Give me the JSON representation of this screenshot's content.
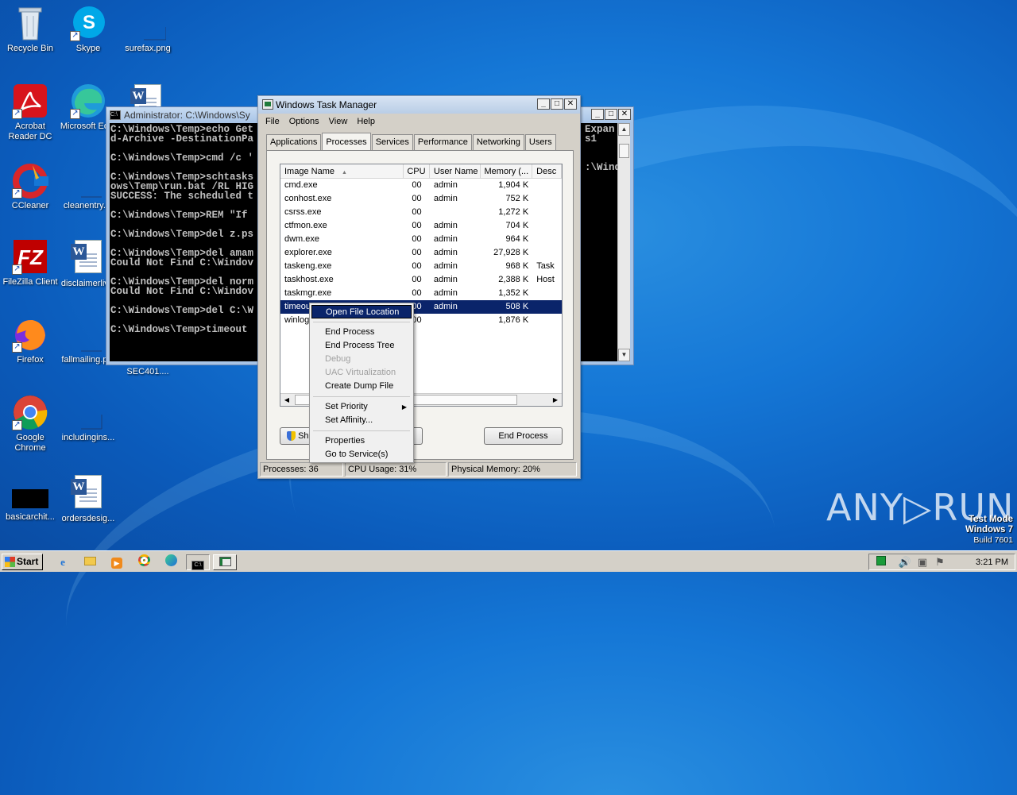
{
  "desktop": {
    "icons": [
      {
        "label": "Recycle Bin",
        "icon": "recycle-bin-icon"
      },
      {
        "label": "Skype",
        "icon": "skype-icon"
      },
      {
        "label": "surefax.png",
        "icon": "image-file-icon"
      },
      {
        "label": "Acrobat Reader DC",
        "icon": "acrobat-icon"
      },
      {
        "label": "Microsoft Ed...",
        "icon": "edge-icon"
      },
      {
        "label": "CCleaner",
        "icon": "ccleaner-icon"
      },
      {
        "label": "cleanentry....",
        "icon": "file-icon"
      },
      {
        "label": "FileZilla Client",
        "icon": "filezilla-icon"
      },
      {
        "label": "disclaimerliv...",
        "icon": "word-doc-icon"
      },
      {
        "label": "Firefox",
        "icon": "firefox-icon"
      },
      {
        "label": "fallmailing.p...",
        "icon": "file-icon"
      },
      {
        "label": "SEC401....",
        "icon": "file-icon"
      },
      {
        "label": "Google Chrome",
        "icon": "chrome-icon"
      },
      {
        "label": "includingins...",
        "icon": "file-icon"
      },
      {
        "label": "basicarchit...",
        "icon": "file-icon"
      },
      {
        "label": "ordersdesig...",
        "icon": "word-doc-icon"
      }
    ]
  },
  "cmd": {
    "title": "Administrator: C:\\Windows\\Sy",
    "lines": [
      "C:\\Windows\\Temp>echo Get",
      "d-Archive -DestinationPa",
      "",
      "C:\\Windows\\Temp>cmd /c '",
      "",
      "C:\\Windows\\Temp>schtasks",
      "ows\\Temp\\run.bat /RL HIG",
      "SUCCESS: The scheduled t",
      "",
      "C:\\Windows\\Temp>REM \"If",
      "",
      "C:\\Windows\\Temp>del z.ps",
      "",
      "C:\\Windows\\Temp>del amam",
      "Could Not Find C:\\Windov",
      "",
      "C:\\Windows\\Temp>del norm",
      "Could Not Find C:\\Windov",
      "",
      "C:\\Windows\\Temp>del C:\\W",
      "",
      "C:\\Windows\\Temp>timeout"
    ],
    "right_lines": [
      "Expan",
      "s1",
      "",
      "",
      ":\\Wind"
    ]
  },
  "taskmgr": {
    "title": "Windows Task Manager",
    "menu": [
      "File",
      "Options",
      "View",
      "Help"
    ],
    "tabs": [
      "Applications",
      "Processes",
      "Services",
      "Performance",
      "Networking",
      "Users"
    ],
    "active_tab": "Processes",
    "columns": [
      "Image Name",
      "CPU",
      "User Name",
      "Memory (...",
      "Desc"
    ],
    "rows": [
      {
        "name": "cmd.exe",
        "cpu": "00",
        "user": "admin",
        "mem": "1,904 K",
        "desc": ""
      },
      {
        "name": "conhost.exe",
        "cpu": "00",
        "user": "admin",
        "mem": "752 K",
        "desc": ""
      },
      {
        "name": "csrss.exe",
        "cpu": "00",
        "user": "",
        "mem": "1,272 K",
        "desc": ""
      },
      {
        "name": "ctfmon.exe",
        "cpu": "00",
        "user": "admin",
        "mem": "704 K",
        "desc": ""
      },
      {
        "name": "dwm.exe",
        "cpu": "00",
        "user": "admin",
        "mem": "964 K",
        "desc": ""
      },
      {
        "name": "explorer.exe",
        "cpu": "00",
        "user": "admin",
        "mem": "27,928 K",
        "desc": ""
      },
      {
        "name": "taskeng.exe",
        "cpu": "00",
        "user": "admin",
        "mem": "968 K",
        "desc": "Task"
      },
      {
        "name": "taskhost.exe",
        "cpu": "00",
        "user": "admin",
        "mem": "2,388 K",
        "desc": "Host"
      },
      {
        "name": "taskmgr.exe",
        "cpu": "00",
        "user": "admin",
        "mem": "1,352 K",
        "desc": ""
      },
      {
        "name": "timeout.exe",
        "cpu": "00",
        "user": "admin",
        "mem": "508 K",
        "desc": ""
      },
      {
        "name": "winlogon.exe",
        "cpu": "00",
        "user": "",
        "mem": "1,876 K",
        "desc": ""
      }
    ],
    "show_processes_label": "Sh",
    "end_process_label": "End Process",
    "status": {
      "processes": "Processes: 36",
      "cpu": "CPU Usage: 31%",
      "memory": "Physical Memory: 20%"
    }
  },
  "context_menu": {
    "items": [
      {
        "label": "Open File Location",
        "state": "highlight"
      },
      {
        "sep": true
      },
      {
        "label": "End Process"
      },
      {
        "label": "End Process Tree"
      },
      {
        "label": "Debug",
        "state": "disabled"
      },
      {
        "label": "UAC Virtualization",
        "state": "disabled"
      },
      {
        "label": "Create Dump File"
      },
      {
        "sep": true
      },
      {
        "label": "Set Priority",
        "submenu": true
      },
      {
        "label": "Set Affinity..."
      },
      {
        "sep": true
      },
      {
        "label": "Properties"
      },
      {
        "label": "Go to Service(s)"
      }
    ]
  },
  "taskbar": {
    "start_label": "Start",
    "clock": "3:21 PM"
  },
  "watermark": {
    "line1": "Test Mode",
    "line2": "Windows 7",
    "line3": "Build 7601",
    "brand": "ANY▷RUN"
  }
}
